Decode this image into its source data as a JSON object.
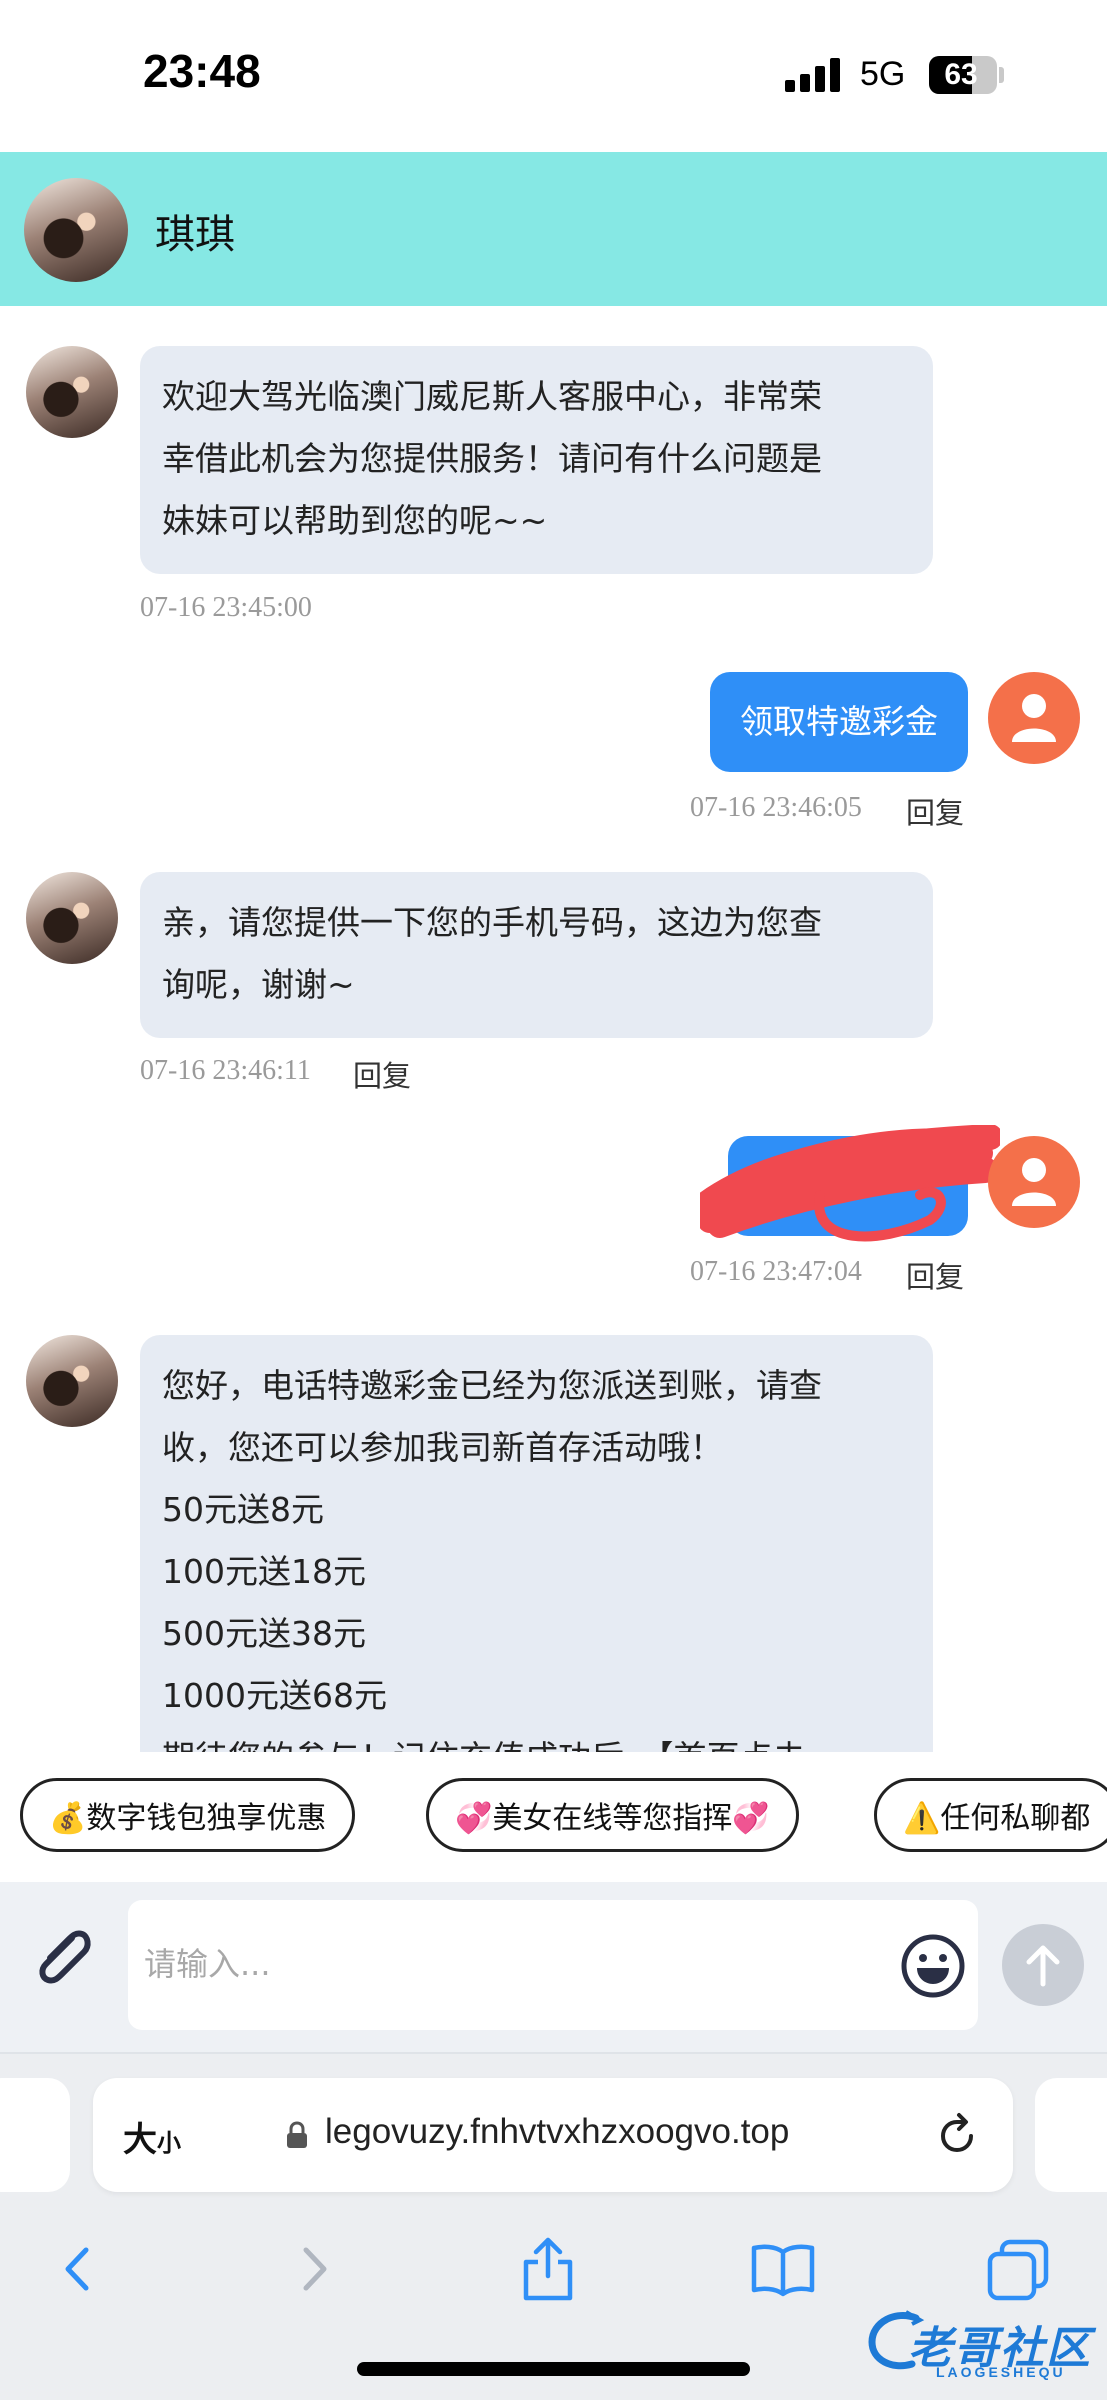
{
  "status_bar": {
    "time": "23:48",
    "network": "5G",
    "battery": "63",
    "battery_level": 0.63
  },
  "chat": {
    "contact_name": "琪琪"
  },
  "messages": [
    {
      "from": "agent",
      "lines": [
        "欢迎大驾光临澳门威尼斯人客服中心，非常荣",
        "幸借此机会为您提供服务！请问有什么问题是",
        "妹妹可以帮助到您的呢~~"
      ],
      "time": "07-16 23:45:00"
    },
    {
      "from": "user",
      "text": "领取特邀彩金",
      "time": "07-16 23:46:05",
      "reply": "回复"
    },
    {
      "from": "agent",
      "lines": [
        "亲，请您提供一下您的手机号码，这边为您查",
        "询呢，谢谢~"
      ],
      "time": "07-16 23:46:11",
      "reply": "回复"
    },
    {
      "from": "user",
      "text": "",
      "redacted": true,
      "time": "07-16 23:47:04",
      "reply": "回复"
    },
    {
      "from": "agent",
      "lines": [
        "您好，电话特邀彩金已经为您派送到账，请查",
        "收，您还可以参加我司新首存活动哦！",
        "50元送8元",
        "100元送18元",
        "500元送38元",
        "1000元送68元",
        "期待您的参与！记住充值成功后，【首页点击"
      ]
    }
  ],
  "quick_replies": [
    "💰数字钱包独享优惠",
    "💞美女在线等您指挥💞",
    "⚠️任何私聊都"
  ],
  "input": {
    "placeholder": "请输入..."
  },
  "browser": {
    "text_size_label": "大",
    "text_size_small": "小",
    "url": "legovuzy.fnhvtvxhzxoogvo.top"
  },
  "toolbar": {
    "icons": [
      "back-icon",
      "forward-icon",
      "share-icon",
      "bookmarks-icon",
      "tabs-icon"
    ]
  },
  "watermark": {
    "main": "老哥社区",
    "sub": "LAOGESHEQU"
  }
}
